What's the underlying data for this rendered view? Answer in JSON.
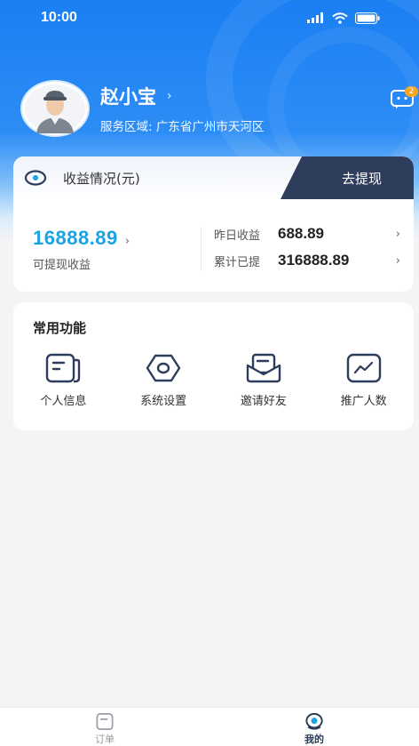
{
  "status_bar": {
    "time": "10:00"
  },
  "profile": {
    "name": "赵小宝",
    "chevron": "›",
    "service_region": "服务区域: 广东省广州市天河区"
  },
  "messages": {
    "badge": "2"
  },
  "earnings": {
    "title": "收益情况(元)",
    "withdraw_label": "去提现",
    "withdrawable_amount": "16888.89",
    "withdrawable_label": "可提现收益",
    "yesterday_label": "昨日收益",
    "yesterday_value": "688.89",
    "total_label": "累计已提",
    "total_value": "316888.89",
    "chevron": "›"
  },
  "functions": {
    "title": "常用功能",
    "items": [
      {
        "label": "个人信息",
        "icon": "profile-card-icon"
      },
      {
        "label": "系统设置",
        "icon": "settings-hexagon-icon"
      },
      {
        "label": "邀请好友",
        "icon": "invite-envelope-icon"
      },
      {
        "label": "推广人数",
        "icon": "trend-chart-icon"
      }
    ]
  },
  "tabbar": {
    "tabs": [
      {
        "label": "订单",
        "icon": "order-icon",
        "active": false
      },
      {
        "label": "我的",
        "icon": "mine-icon",
        "active": true
      }
    ]
  },
  "colors": {
    "header_blue": "#1a7ff3",
    "amount_blue": "#1aa3e3",
    "withdraw_bg": "#2e3d5c",
    "badge_orange": "#f5a623"
  }
}
